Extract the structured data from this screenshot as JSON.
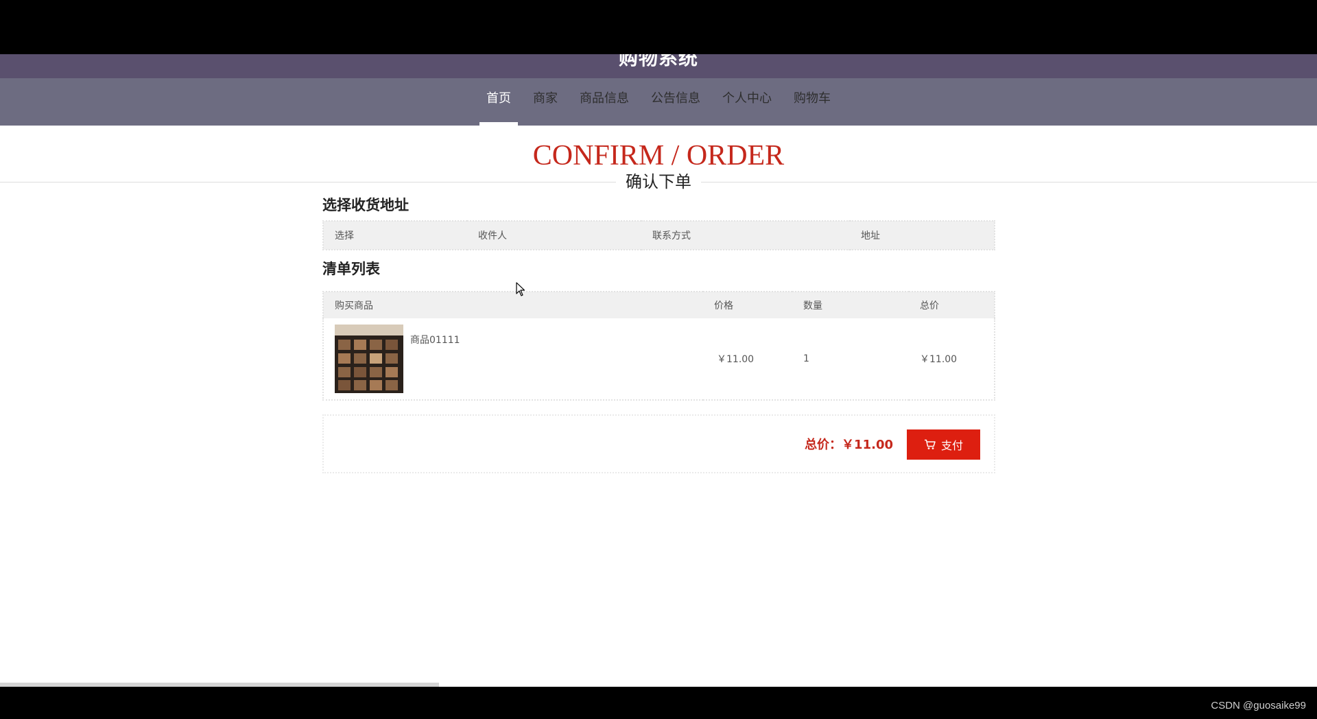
{
  "site": {
    "title": "购物系统"
  },
  "nav": {
    "items": [
      {
        "label": "首页",
        "active": true
      },
      {
        "label": "商家"
      },
      {
        "label": "商品信息"
      },
      {
        "label": "公告信息"
      },
      {
        "label": "个人中心"
      },
      {
        "label": "购物车"
      }
    ]
  },
  "page": {
    "title_en": "CONFIRM / ORDER",
    "title_cn": "确认下单"
  },
  "address": {
    "section_title": "选择收货地址",
    "columns": [
      "选择",
      "收件人",
      "联系方式",
      "地址"
    ]
  },
  "list": {
    "section_title": "清单列表",
    "columns": [
      "购买商品",
      "价格",
      "数量",
      "总价"
    ],
    "rows": [
      {
        "product": "商品01111",
        "price": "￥11.00",
        "quantity": "1",
        "total": "￥11.00"
      }
    ]
  },
  "summary": {
    "total_label": "总价：￥11.00",
    "pay_label": "支付"
  },
  "footer": {
    "watermark": "CSDN @guosaike99"
  },
  "colors": {
    "accent_red": "#c5281c",
    "pay_button": "#dd1f10",
    "header_dark": "#5a506e",
    "nav_bar": "#6d6c81"
  }
}
